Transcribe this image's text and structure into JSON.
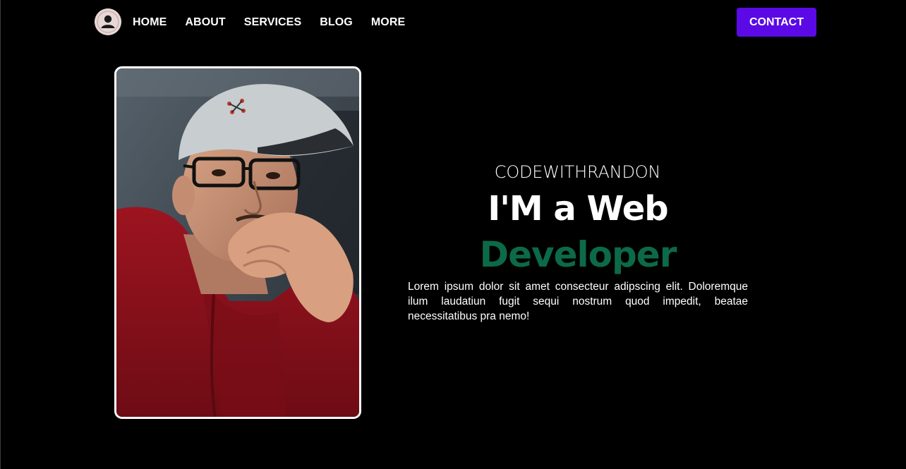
{
  "nav": {
    "logo_icon": "user-avatar-icon",
    "links": [
      "HOME",
      "ABOUT",
      "SERVICES",
      "BLOG",
      "MORE"
    ],
    "contact_label": "CONTACT"
  },
  "hero": {
    "kicker": "CODEWITHRANDON",
    "headline": "I'M a Web",
    "headline_accent": "Developer",
    "bio": "Lorem ipsum dolor sit amet consecteur adipscing elit. Doloremque ilum laudatiun fugit sequi nostrum quod impedit, beatae necessitatibus pra nemo!"
  },
  "colors": {
    "background": "#000000",
    "accent_button": "#5b0ae6",
    "accent_text": "#0c6a48",
    "text": "#ffffff"
  }
}
